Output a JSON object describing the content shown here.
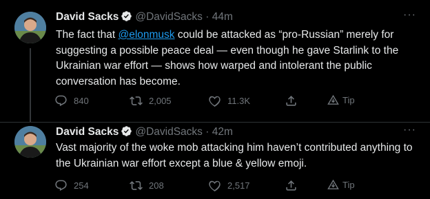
{
  "tweets": [
    {
      "name": "David Sacks",
      "handle": "@DavidSacks",
      "separator": "·",
      "time": "44m",
      "more": "···",
      "text_before": "The fact that ",
      "mention": "@elonmusk",
      "text_after": " could be attacked as “pro-Russian” merely for suggesting a possible peace deal — even though he gave Starlink to the Ukrainian war effort — shows how warped and intolerant the public conversation has become.",
      "replies": "840",
      "retweets": "2,005",
      "likes": "11.3K",
      "tip": "Tip"
    },
    {
      "name": "David Sacks",
      "handle": "@DavidSacks",
      "separator": "·",
      "time": "42m",
      "more": "···",
      "text": "Vast majority of the woke mob attacking him haven’t contributed anything to the Ukrainian war effort except a blue & yellow emoji.",
      "replies": "254",
      "retweets": "208",
      "likes": "2,517",
      "tip": "Tip"
    }
  ],
  "colors": {
    "background": "#000000",
    "text": "#e7e9ea",
    "muted": "#71767b",
    "accent": "#1d9bf0",
    "divider": "#2f3336"
  },
  "icons": [
    "verified-badge-icon",
    "reply-icon",
    "retweet-icon",
    "like-icon",
    "share-icon",
    "tip-icon",
    "more-icon"
  ]
}
